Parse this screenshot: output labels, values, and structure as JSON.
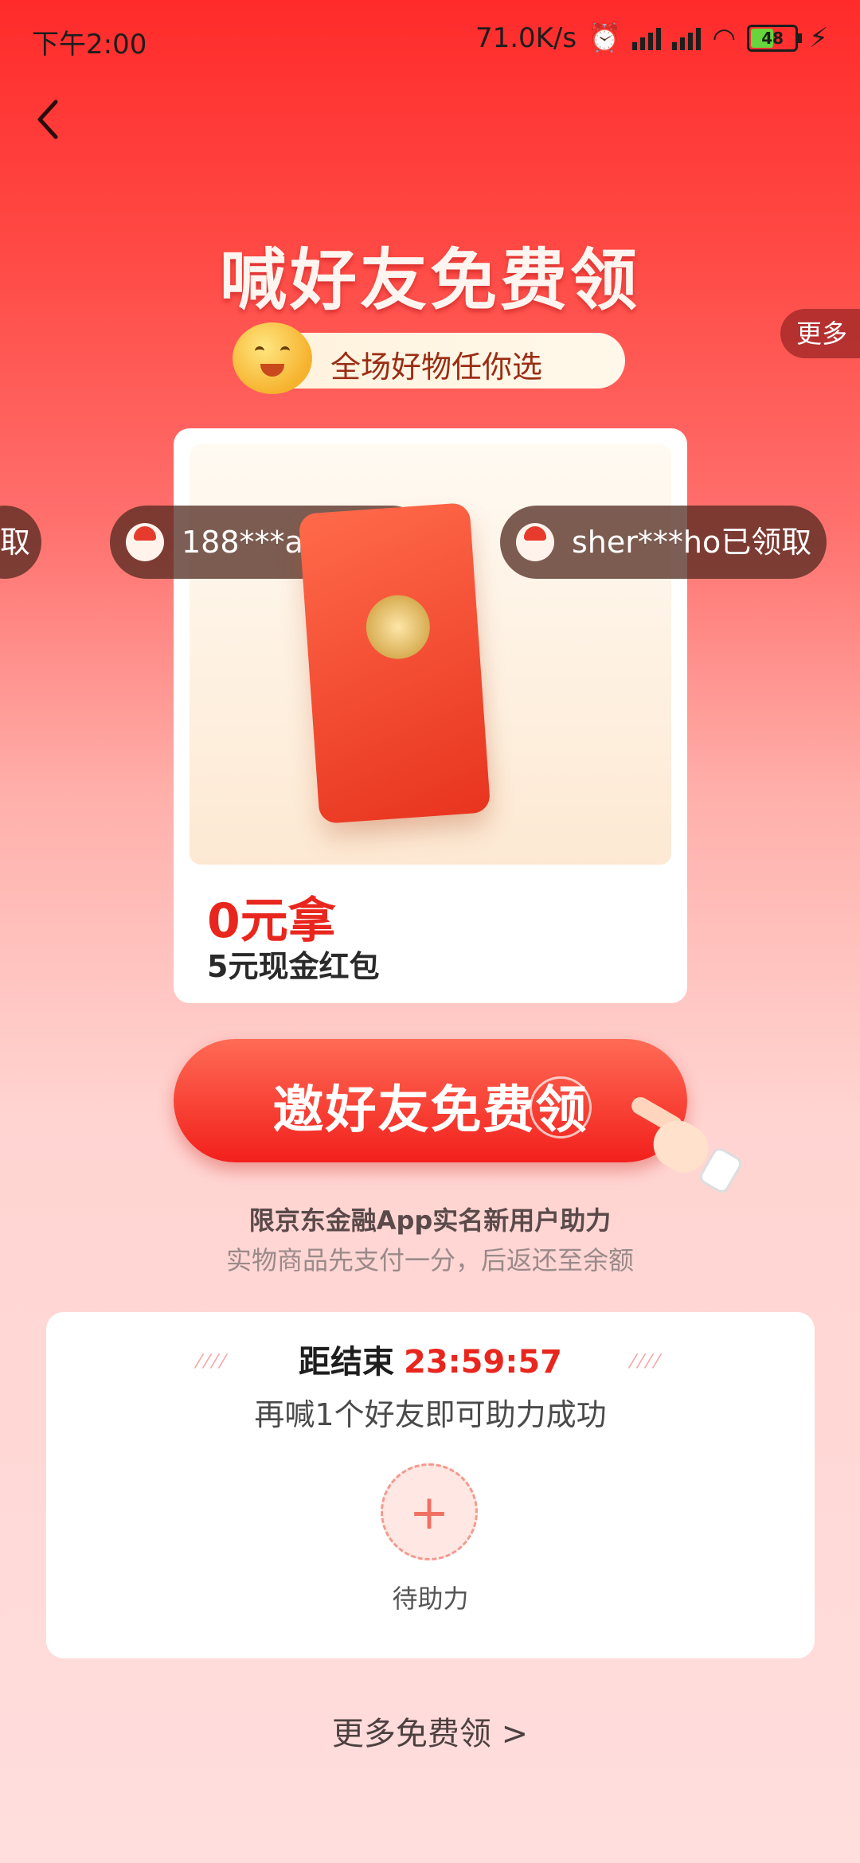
{
  "status_bar": {
    "time": "下午2:00",
    "net_speed": "71.0K/s",
    "battery": "48"
  },
  "header": {
    "back_icon": "chevron-left-icon",
    "title": "喊好友免费领",
    "subtitle": "全场好物任你选",
    "side_more": "更多"
  },
  "tickers": [
    {
      "text": "取"
    },
    {
      "text": "188***aq已领取"
    },
    {
      "text": "sher***ho已领取"
    }
  ],
  "product": {
    "price_label": "0元拿",
    "name": "5元现金红包"
  },
  "cta": {
    "label": "邀好友免费领"
  },
  "notes": {
    "line1": "限京东金融App实名新用户助力",
    "line2": "实物商品先支付一分，后返还至余额"
  },
  "assist_panel": {
    "countdown_label": "距结束",
    "countdown_value": "23:59:57",
    "message": "再喊1个好友即可助力成功",
    "slot_label": "待助力",
    "slot_icon": "plus-icon"
  },
  "footer": {
    "more_link": "更多免费领 >"
  },
  "colors": {
    "accent_red": "#e8261d",
    "bg_top": "#ff2b2b",
    "bg_bottom": "#ffdedd"
  }
}
